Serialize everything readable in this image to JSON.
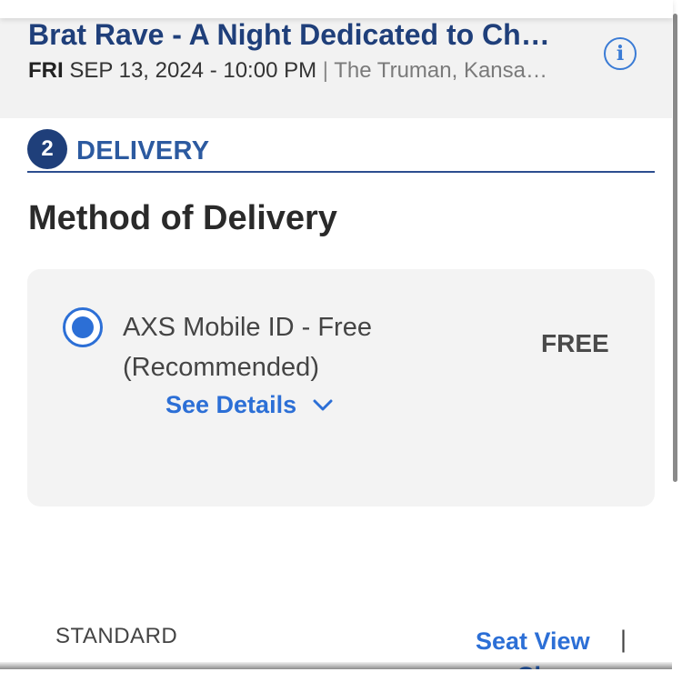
{
  "event": {
    "title": "Brat Rave - A Night Dedicated to Ch…",
    "day": "FRI",
    "datetime": "SEP 13, 2024 - 10:00 PM",
    "separator": "|",
    "venue": "The Truman, Kansa…",
    "info_icon": "info-icon",
    "info_glyph": "i"
  },
  "step": {
    "number": "2",
    "label": "DELIVERY"
  },
  "delivery": {
    "section_title": "Method of Delivery",
    "options": [
      {
        "label": "AXS Mobile ID - Free (Recommended)",
        "price": "FREE",
        "selected": true,
        "details_label": "See Details",
        "details_icon": "chevron-down-icon"
      }
    ]
  },
  "footer": {
    "standard_label": "STANDARD",
    "seat_view_label": "Seat View",
    "seat_view_clipped": "Ch",
    "separator": "|"
  },
  "colors": {
    "title_blue": "#1f3f7a",
    "link_blue": "#2c6fd6",
    "header_bg": "#f2f2f2",
    "card_bg": "#f3f3f3"
  }
}
